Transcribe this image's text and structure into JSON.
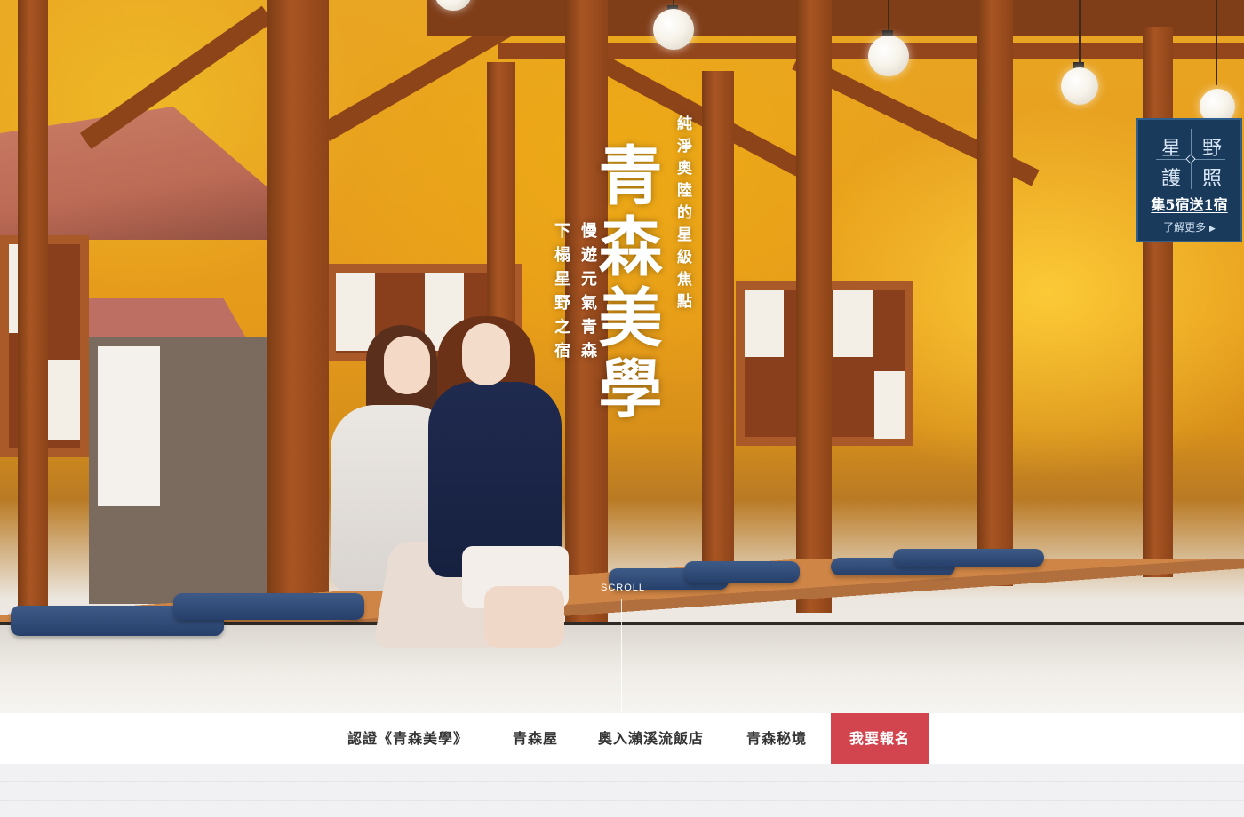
{
  "hero": {
    "title": "青森美學",
    "subtitle": "純淨奧陸的星級焦點",
    "tagline_1": "慢遊元氣青森",
    "tagline_2": "下榻星野之宿",
    "scroll_label": "SCROLL"
  },
  "badge": {
    "char_1": "星",
    "char_2": "野",
    "char_3": "護",
    "char_4": "照",
    "offer": "集5宿送1宿",
    "more_label": "了解更多",
    "more_icon": "triangle-right-icon"
  },
  "nav": {
    "items": [
      {
        "label": "認證《青森美學》"
      },
      {
        "label": "青森屋"
      },
      {
        "label": "奧入瀨溪流飯店"
      },
      {
        "label": "青森秘境"
      }
    ],
    "cta_label": "我要報名"
  },
  "colors": {
    "cta": "#d2454f",
    "badge_bg": "#1a3a5c",
    "foliage": "#e9a623"
  }
}
